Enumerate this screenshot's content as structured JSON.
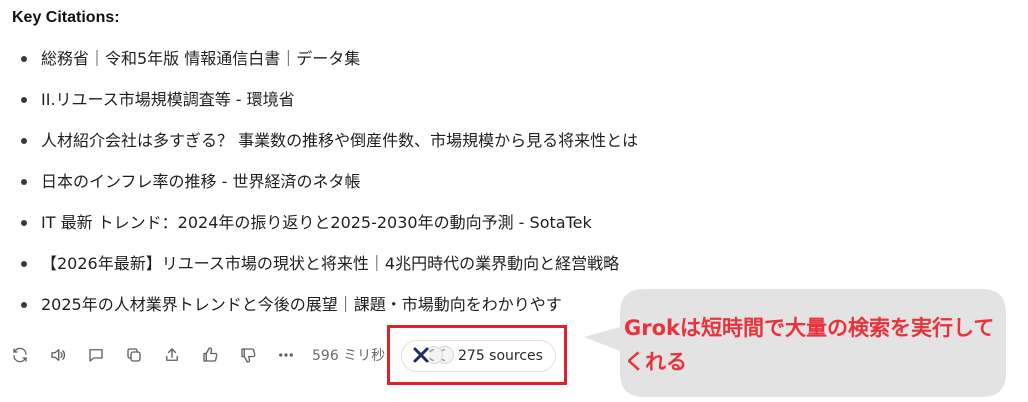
{
  "heading": "Key Citations:",
  "citations": [
    "総務省｜令和5年版 情報通信白書｜データ集",
    "II.リユース市場規模調査等 - 環境省",
    "人材紹介会社は多すぎる？ 事業数の推移や倒産件数、市場規模から見る将来性とは",
    "日本のインフレ率の推移 - 世界経済のネタ帳",
    "IT 最新 トレンド：2024年の振り返りと2025-2030年の動向予測 - SotaTek",
    "【2026年最新】リユース市場の現状と将来性｜4兆円時代の業界動向と経営戦略",
    "2025年の人材業界トレンドと今後の展望｜課題・市場動向をわかりやす"
  ],
  "action_bar": {
    "icons": [
      "regenerate-icon",
      "read-aloud-icon",
      "comment-icon",
      "copy-icon",
      "share-icon",
      "thumbs-up-icon",
      "thumbs-down-icon",
      "more-icon"
    ],
    "elapsed": "596 ミリ秒"
  },
  "sources": {
    "label": "275 sources",
    "favicons": [
      "x-logo-icon",
      "source-favicon-icon",
      "source-favicon-icon"
    ]
  },
  "annotation": {
    "text": "Grokは短時間で大量の検索を実行してくれる",
    "text_color": "#e8323c",
    "box_color": "#e0202a",
    "bubble_color": "#e3e3e3"
  }
}
